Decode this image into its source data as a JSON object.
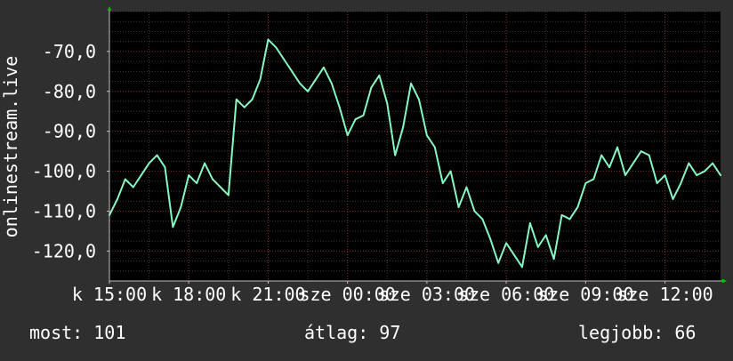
{
  "chart_data": {
    "type": "line",
    "title": "",
    "xlabel": "",
    "ylabel": "onlinestream.live",
    "ylim": [
      -127.5,
      -60
    ],
    "yticks": [
      -70,
      -80,
      -90,
      -100,
      -110,
      -120
    ],
    "ytick_labels": [
      "-70,0",
      "-80,0",
      "-90,0",
      "-100,0",
      "-110,0",
      "-120,0"
    ],
    "xticks": [
      {
        "label": "k 15:00",
        "pos": 0
      },
      {
        "label": "k 18:00",
        "pos": 1
      },
      {
        "label": "k 21:00",
        "pos": 2
      },
      {
        "label": "sze 00:00",
        "pos": 3
      },
      {
        "label": "sze 03:00",
        "pos": 4
      },
      {
        "label": "sze 06:00",
        "pos": 5
      },
      {
        "label": "sze 09:00",
        "pos": 6
      },
      {
        "label": "sze 12:00",
        "pos": 7
      }
    ],
    "x": [
      0,
      0.1,
      0.2,
      0.3,
      0.4,
      0.5,
      0.6,
      0.7,
      0.8,
      0.9,
      1,
      1.1,
      1.2,
      1.3,
      1.4,
      1.5,
      1.6,
      1.7,
      1.8,
      1.9,
      2,
      2.1,
      2.2,
      2.3,
      2.4,
      2.5,
      2.6,
      2.7,
      2.8,
      2.9,
      3,
      3.1,
      3.2,
      3.3,
      3.4,
      3.5,
      3.6,
      3.7,
      3.8,
      3.9,
      4,
      4.1,
      4.2,
      4.3,
      4.4,
      4.5,
      4.6,
      4.7,
      4.8,
      4.9,
      5,
      5.1,
      5.2,
      5.3,
      5.4,
      5.5,
      5.6,
      5.7,
      5.8,
      5.9,
      6,
      6.1,
      6.2,
      6.3,
      6.4,
      6.5,
      6.6,
      6.7,
      6.8,
      6.9,
      7,
      7.1,
      7.2,
      7.3,
      7.4,
      7.5,
      7.6,
      7.7
    ],
    "series": [
      {
        "name": "",
        "color": "#86f7c2",
        "values": [
          -111,
          -107,
          -102,
          -104,
          -101,
          -98,
          -96,
          -99,
          -114,
          -109,
          -101,
          -103,
          -98,
          -102,
          -104,
          -106,
          -82,
          -84,
          -82,
          -77,
          -67,
          -69,
          -72,
          -75,
          -78,
          -80,
          -77,
          -74,
          -78,
          -84,
          -91,
          -87,
          -86,
          -79,
          -76,
          -83,
          -96,
          -89,
          -78,
          -82,
          -91,
          -94,
          -103,
          -100,
          -109,
          -104,
          -110,
          -112,
          -117,
          -123,
          -118,
          -121,
          -124,
          -113,
          -119,
          -116,
          -122,
          -111,
          -112,
          -109,
          -103,
          -102,
          -96,
          -99,
          -94,
          -101,
          -98,
          -95,
          -96,
          -103,
          -101,
          -107,
          -103,
          -98,
          -101,
          -100,
          -98,
          -101
        ]
      }
    ],
    "summary": {
      "current_label": "most:",
      "current_value": "101",
      "average_label": "átlag:",
      "average_value": "97",
      "max_label": "legjobb:",
      "max_value": "66"
    },
    "grid": true,
    "legend": "bottom",
    "colors": {
      "background": "#2f2f2f",
      "plot_background": "#000000",
      "grid_major": "#7f2a2a",
      "grid_minor": "#3b3b3b",
      "axis": "#bfbfbf",
      "axis_arrow": "#00c000",
      "text": "#ffffff"
    }
  }
}
